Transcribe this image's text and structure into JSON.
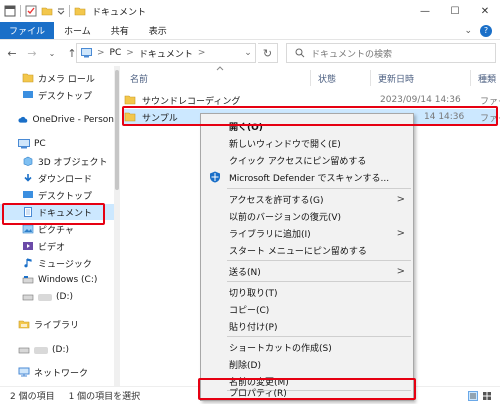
{
  "window": {
    "title": "ドキュメント",
    "controls": {
      "minimize": "—",
      "maximize": "☐",
      "close": "✕"
    }
  },
  "ribbon": {
    "tabs": [
      "ファイル",
      "ホーム",
      "共有",
      "表示"
    ],
    "collapse_glyph": "⌄",
    "help_glyph": "?"
  },
  "address": {
    "crumbs": [
      "PC",
      "ドキュメント"
    ],
    "separator": ">",
    "search_placeholder": "ドキュメントの検索"
  },
  "sidebar": {
    "items": [
      {
        "label": "カメラ ロール",
        "icon": "folder-icon"
      },
      {
        "label": "デスクトップ",
        "icon": "desktop-icon"
      },
      {
        "label": "OneDrive - Person",
        "icon": "cloud-icon"
      },
      {
        "label": "PC",
        "icon": "pc-icon"
      },
      {
        "label": "3D オブジェクト",
        "icon": "cube-icon"
      },
      {
        "label": "ダウンロード",
        "icon": "download-icon"
      },
      {
        "label": "デスクトップ",
        "icon": "desktop-icon"
      },
      {
        "label": "ドキュメント",
        "icon": "document-icon"
      },
      {
        "label": "ピクチャ",
        "icon": "picture-icon"
      },
      {
        "label": "ビデオ",
        "icon": "video-icon"
      },
      {
        "label": "ミュージック",
        "icon": "music-icon"
      },
      {
        "label": "Windows (C:)",
        "icon": "drive-icon"
      },
      {
        "label": "(D:)",
        "icon": "drive-icon"
      },
      {
        "label": "ライブラリ",
        "icon": "library-icon"
      },
      {
        "label": "(D:)",
        "icon": "drive-icon"
      },
      {
        "label": "ネットワーク",
        "icon": "network-icon"
      }
    ]
  },
  "columns": [
    "名前",
    "状態",
    "更新日時",
    "種類"
  ],
  "files": [
    {
      "name": "サウンドレコーディング",
      "date": "2023/09/14 14:36",
      "type": "ファイ"
    },
    {
      "name": "サンプル",
      "date": "14 14:36",
      "type": "ファイ"
    }
  ],
  "context_menu": {
    "open": "開く(O)",
    "open_new_window": "新しいウィンドウで開く(E)",
    "pin_quick_access": "クイック アクセスにピン留めする",
    "defender_scan": "Microsoft Defender でスキャンする...",
    "grant_access": "アクセスを許可する(G)",
    "restore_versions": "以前のバージョンの復元(V)",
    "add_to_library": "ライブラリに追加(I)",
    "pin_start": "スタート メニューにピン留めする",
    "send_to": "送る(N)",
    "cut": "切り取り(T)",
    "copy": "コピー(C)",
    "paste": "貼り付け(P)",
    "create_shortcut": "ショートカットの作成(S)",
    "delete": "削除(D)",
    "rename": "名前の変更(M)",
    "properties": "プロパティ(R)",
    "submenu_arrow": ">"
  },
  "status": {
    "item_count": "2 個の項目",
    "selected": "1 個の項目を選択"
  },
  "colors": {
    "accent": "#1a6fc8",
    "selection": "#cce8ff",
    "highlight_box": "#e60012"
  }
}
